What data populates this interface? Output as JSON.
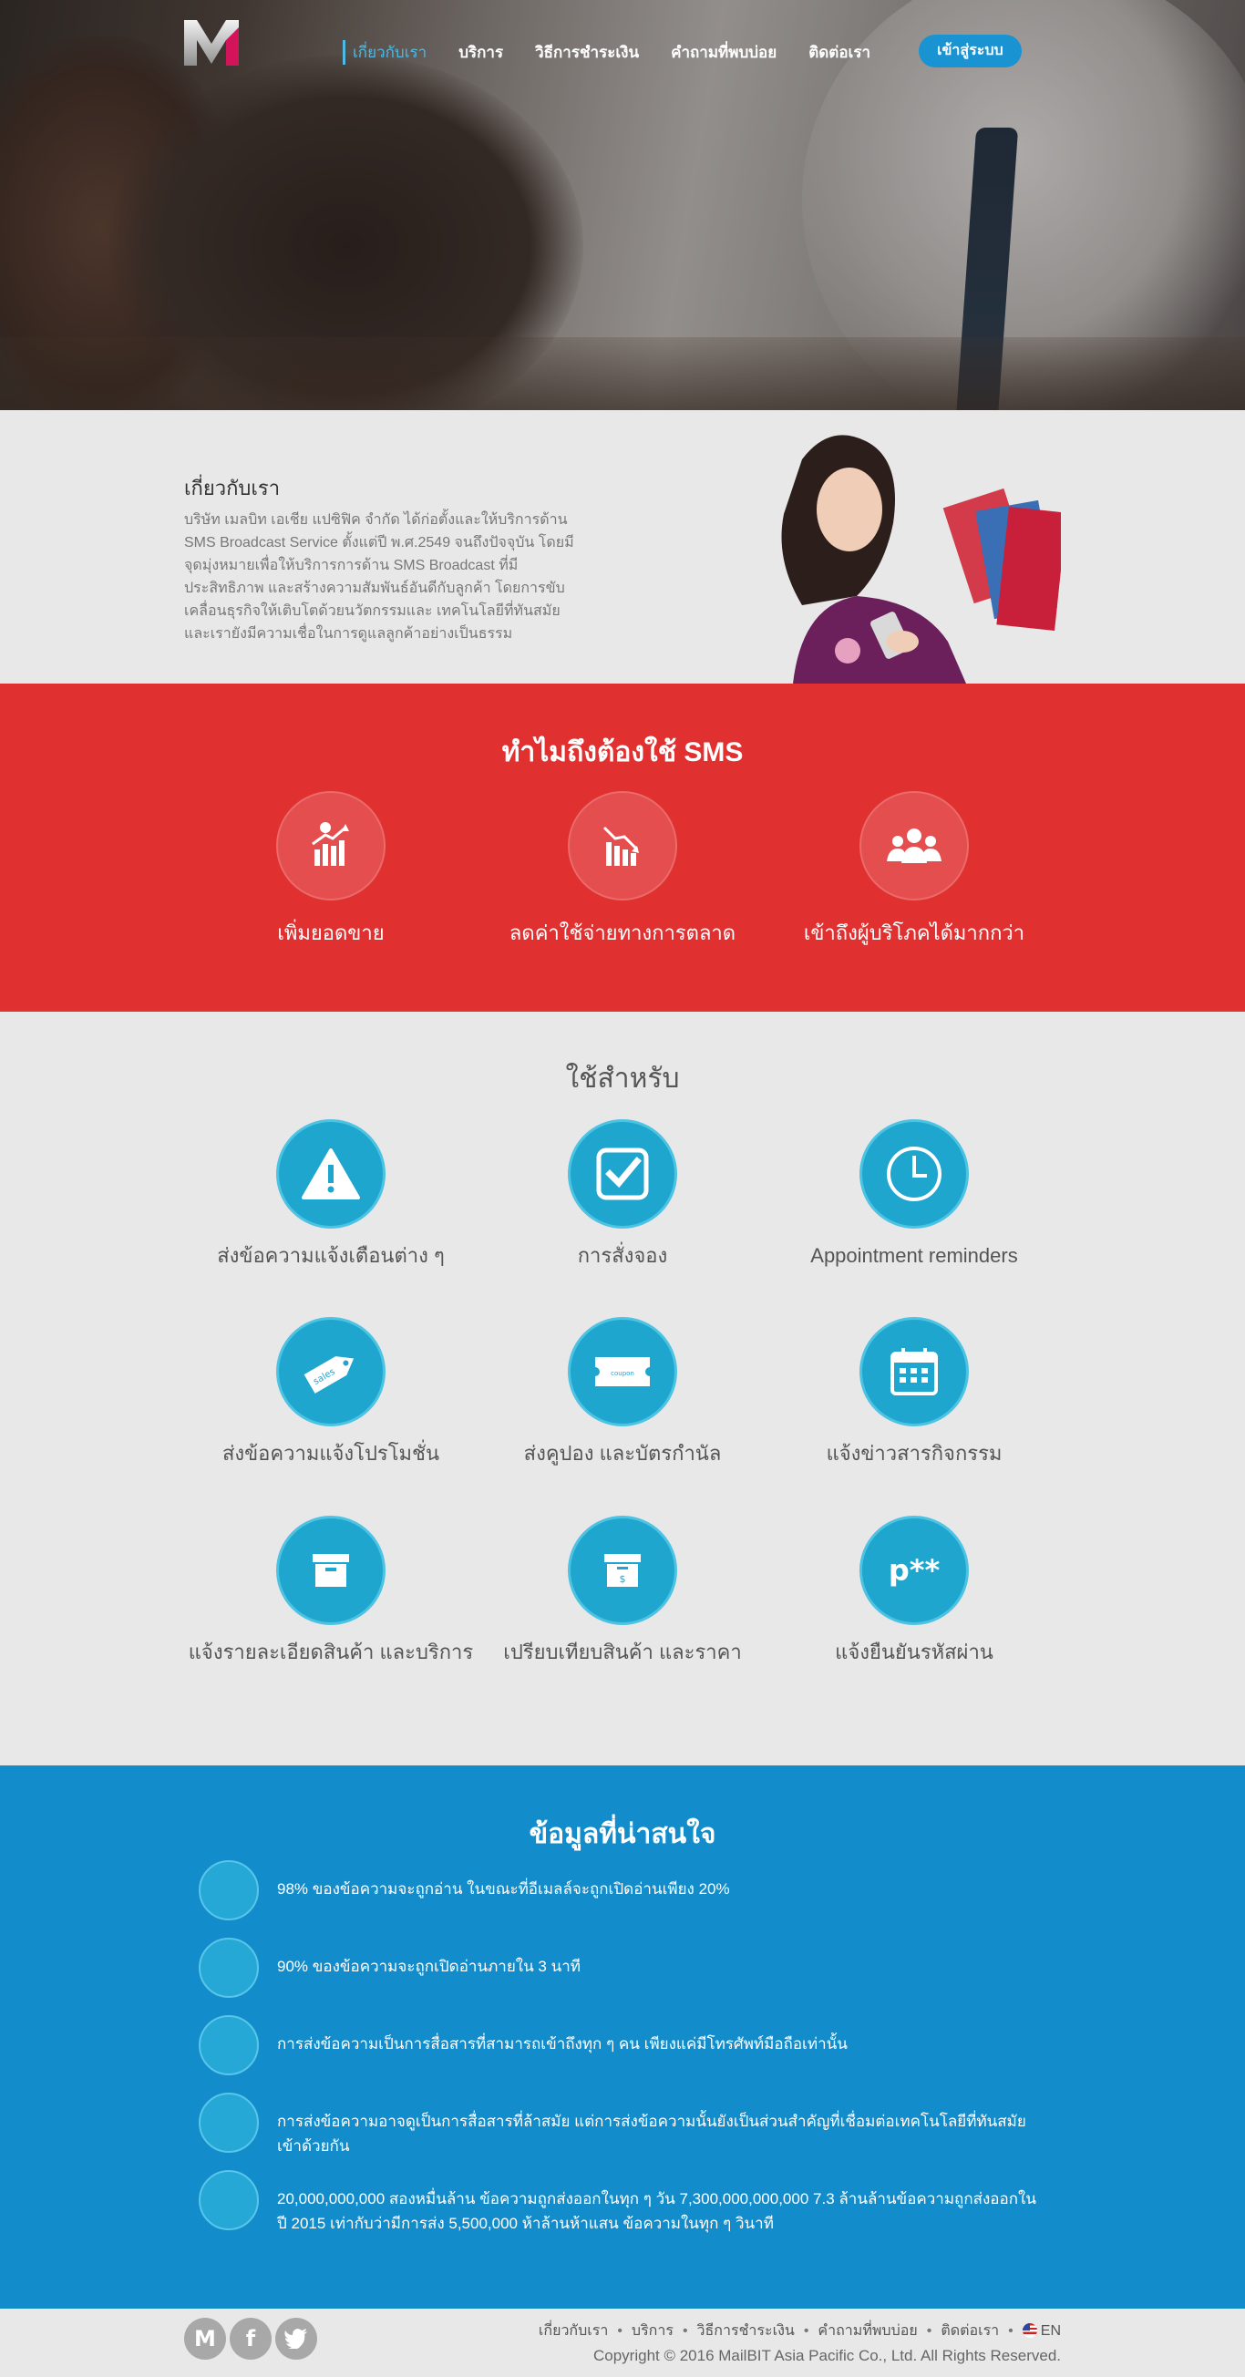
{
  "nav": {
    "items": [
      {
        "label": "เกี่ยวกับเรา"
      },
      {
        "label": "บริการ"
      },
      {
        "label": "วิธีการชำระเงิน"
      },
      {
        "label": "คำถามที่พบบ่อย"
      },
      {
        "label": "ติดต่อเรา"
      }
    ],
    "login_label": "เข้าสู่ระบบ"
  },
  "about": {
    "title": "เกี่ยวกับเรา",
    "text": "บริษัท เมลบิท เอเชีย แปซิฟิค จำกัด ได้ก่อตั้งและให้บริการด้าน SMS Broadcast Service ตั้งแต่ปี พ.ศ.2549 จนถึงปัจจุบัน โดยมีจุดมุ่งหมายเพื่อให้บริการการด้าน SMS Broadcast ที่มีประสิทธิภาพ และสร้างความสัมพันธ์อันดีกับลูกค้า โดยการขับเคลื่อนธุรกิจให้เติบโตด้วยนวัตกรรมและ เทคโนโลยีที่ทันสมัย และเรายังมีความเชื่อในการดูแลลูกค้าอย่างเป็นธรรม"
  },
  "why": {
    "title": "ทำไมถึงต้องใช้ SMS",
    "items": [
      {
        "label": "เพิ่มยอดขาย",
        "icon": "sales-growth-icon"
      },
      {
        "label": "ลดค่าใช้จ่ายทางการตลาด",
        "icon": "cost-decrease-icon"
      },
      {
        "label": "เข้าถึงผู้บริโภคได้มากกว่า",
        "icon": "people-group-icon"
      }
    ]
  },
  "uses": {
    "title": "ใช้สำหรับ",
    "items": [
      {
        "label": "ส่งข้อความแจ้งเตือนต่าง ๆ",
        "icon": "warning-icon"
      },
      {
        "label": "การสั่งจอง",
        "icon": "checkbox-icon"
      },
      {
        "label": "Appointment reminders",
        "icon": "clock-icon"
      },
      {
        "label": "ส่งข้อความแจ้งโปรโมชั่น",
        "icon": "sales-tag-icon",
        "tag_text": "sales"
      },
      {
        "label": "ส่งคูปอง และบัตรกำนัล",
        "icon": "coupon-icon",
        "tag_text": "coupon"
      },
      {
        "label": "แจ้งข่าวสารกิจกรรม",
        "icon": "calendar-icon"
      },
      {
        "label": "แจ้งรายละเอียดสินค้า และบริการ",
        "icon": "product-box-icon"
      },
      {
        "label": "เปรียบเทียบสินค้า และราคา",
        "icon": "price-box-icon"
      },
      {
        "label": "แจ้งยืนยันรหัสผ่าน",
        "icon": "password-icon",
        "icon_text": "p**"
      }
    ]
  },
  "facts": {
    "title": "ข้อมูลที่น่าสนใจ",
    "items": [
      {
        "text": "98% ของข้อความจะถูกอ่าน ในขณะที่อีเมลล์จะถูกเปิดอ่านเพียง 20%"
      },
      {
        "text": "90% ของข้อความจะถูกเปิดอ่านภายใน 3 นาที"
      },
      {
        "text": "การส่งข้อความเป็นการสื่อสารที่สามารถเข้าถึงทุก ๆ คน เพียงแค่มีโทรศัพท์มือถือเท่านั้น"
      },
      {
        "text": "การส่งข้อความอาจดูเป็นการสื่อสารที่ล้าสมัย แต่การส่งข้อความนั้นยังเป็นส่วนสำคัญที่เชื่อมต่อเทคโนโลยีที่ทันสมัยเข้าด้วยกัน"
      },
      {
        "text": "20,000,000,000 สองหมื่นล้าน ข้อความถูกส่งออกในทุก ๆ วัน 7,300,000,000,000 7.3 ล้านล้านข้อความถูกส่งออกในปี 2015 เท่ากับว่ามีการส่ง 5,500,000 ห้าล้านห้าแสน ข้อความในทุก ๆ วินาที"
      }
    ]
  },
  "footer": {
    "social": [
      {
        "icon": "mailbit-icon",
        "glyph": "M"
      },
      {
        "icon": "facebook-icon",
        "glyph": "f"
      },
      {
        "icon": "twitter-icon",
        "glyph": "t"
      }
    ],
    "links": [
      {
        "label": "เกี่ยวกับเรา"
      },
      {
        "label": "บริการ"
      },
      {
        "label": "วิธีการชำระเงิน"
      },
      {
        "label": "คำถามที่พบบ่อย"
      },
      {
        "label": "ติดต่อเรา"
      }
    ],
    "lang_label": "EN",
    "copyright": "Copyright © 2016 MailBIT Asia Pacific Co., Ltd. All Rights Reserved."
  },
  "colors": {
    "primary_blue": "#138ccb",
    "accent_red": "#e03030",
    "icon_teal": "#1fa6ce",
    "logo_magenta": "#d4145a"
  }
}
